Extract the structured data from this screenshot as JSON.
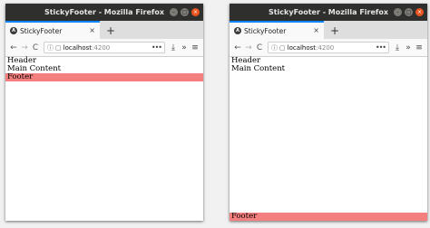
{
  "windows": [
    {
      "title": "StickyFooter - Mozilla Firefox",
      "tab_title": "StickyFooter",
      "url_host": "localhost",
      "url_port": ":4200",
      "page": {
        "header": "Header",
        "main": "Main Content",
        "footer": "Footer"
      }
    },
    {
      "title": "StickyFooter - Mozilla Firefox",
      "tab_title": "StickyFooter",
      "url_host": "localhost",
      "url_port": ":4200",
      "page": {
        "header": "Header",
        "main": "Main Content",
        "footer": "Footer"
      }
    }
  ],
  "icons": {
    "minimize": "–",
    "maximize": "□",
    "close": "×",
    "tab_close": "×",
    "new_tab": "+",
    "back": "←",
    "forward": "→",
    "reload": "C",
    "info": "ⓘ",
    "page": "▢",
    "more": "•••",
    "download": "⤓",
    "overflow": "»",
    "menu": "≡",
    "angular": "A"
  },
  "colors": {
    "footer_bg": "#f47f7f",
    "titlebar_bg": "#2f2f2e",
    "close_button": "#e9541f",
    "tab_accent": "#0a84ff"
  }
}
